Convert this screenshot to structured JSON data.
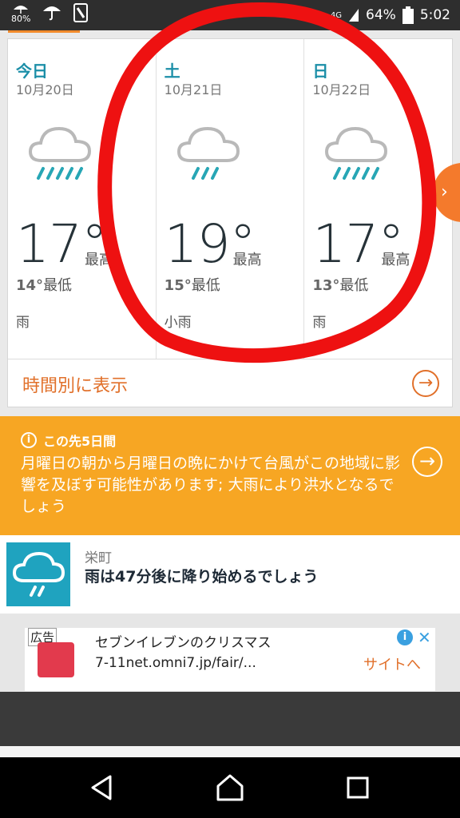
{
  "status_bar": {
    "weather_percent": "80%",
    "network": "4G",
    "battery": "64%",
    "time": "5:02"
  },
  "forecast": {
    "days": [
      {
        "name": "今日",
        "date": "10月20日",
        "high": "17°",
        "high_label": "最高",
        "low": "14°",
        "low_label": "最低",
        "condition": "雨",
        "icon": "rain-cloud-icon"
      },
      {
        "name": "土",
        "date": "10月21日",
        "high": "19°",
        "high_label": "最高",
        "low": "15°",
        "low_label": "最低",
        "condition": "小雨",
        "icon": "light-rain-cloud-icon"
      },
      {
        "name": "日",
        "date": "10月22日",
        "high": "17°",
        "high_label": "最高",
        "low": "13°",
        "low_label": "最低",
        "condition": "雨",
        "icon": "rain-cloud-icon"
      }
    ],
    "hourly_link": "時間別に表示"
  },
  "alert": {
    "title": "この先5日間",
    "text": "月曜日の朝から月曜日の晩にかけて台風がこの地域に影響を及ぼす可能性があります; 大雨により洪水となるでしょう"
  },
  "nowcast": {
    "place": "栄町",
    "message": "雨は47分後に降り始めるでしょう"
  },
  "ad": {
    "label": "広告",
    "title": "セブンイレブンのクリスマス",
    "url": "7-11net.omni7.jp/fair/...",
    "cta": "サイトへ"
  },
  "colors": {
    "accent": "#f28b2c",
    "teal": "#1c8fa8",
    "alert_bg": "#f7a623",
    "annotation": "#ee1111"
  }
}
